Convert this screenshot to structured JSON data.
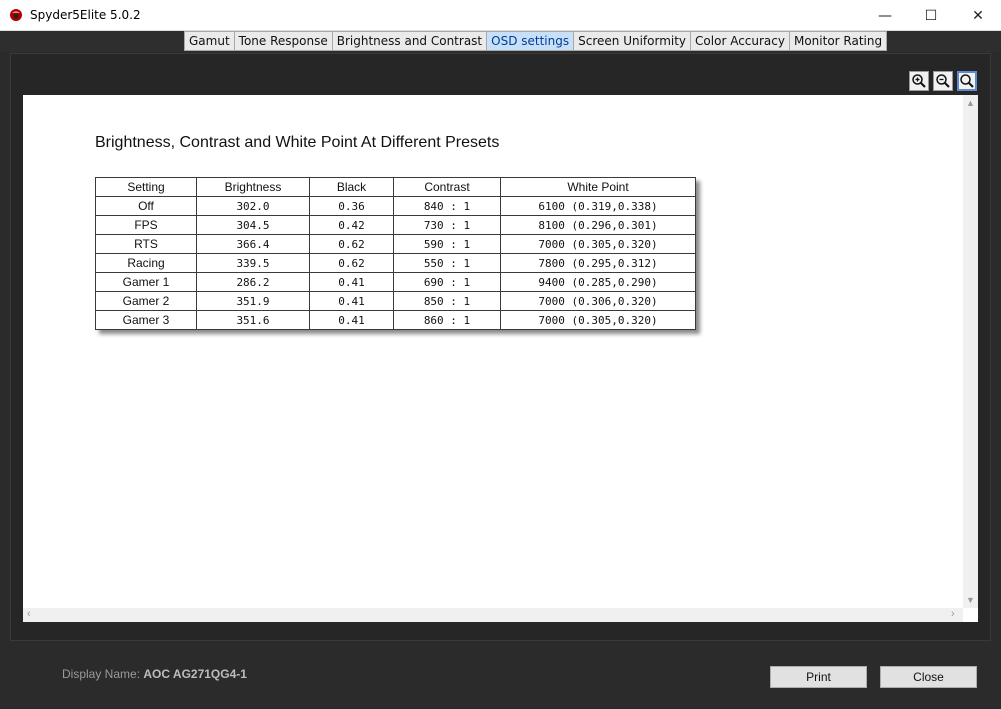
{
  "window": {
    "title": "Spyder5Elite 5.0.2",
    "minimize": "—",
    "maximize": "☐",
    "close": "✕"
  },
  "tabs": [
    {
      "label": "Gamut",
      "active": false
    },
    {
      "label": "Tone Response",
      "active": false
    },
    {
      "label": "Brightness and Contrast",
      "active": false
    },
    {
      "label": "OSD settings",
      "active": true
    },
    {
      "label": "Screen Uniformity",
      "active": false
    },
    {
      "label": "Color Accuracy",
      "active": false
    },
    {
      "label": "Monitor Rating",
      "active": false
    }
  ],
  "zoom_tools": [
    {
      "name": "zoom-in-icon"
    },
    {
      "name": "zoom-out-icon"
    },
    {
      "name": "zoom-fit-icon"
    }
  ],
  "report": {
    "title": "Brightness, Contrast and White Point At Different Presets",
    "columns": [
      "Setting",
      "Brightness",
      "Black",
      "Contrast",
      "White Point"
    ],
    "rows": [
      [
        "Off",
        "302.0",
        "0.36",
        "840 : 1",
        "6100 (0.319,0.338)"
      ],
      [
        "FPS",
        "304.5",
        "0.42",
        "730 : 1",
        "8100 (0.296,0.301)"
      ],
      [
        "RTS",
        "366.4",
        "0.62",
        "590 : 1",
        "7000 (0.305,0.320)"
      ],
      [
        "Racing",
        "339.5",
        "0.62",
        "550 : 1",
        "7800 (0.295,0.312)"
      ],
      [
        "Gamer 1",
        "286.2",
        "0.41",
        "690 : 1",
        "9400 (0.285,0.290)"
      ],
      [
        "Gamer 2",
        "351.9",
        "0.41",
        "850 : 1",
        "7000 (0.306,0.320)"
      ],
      [
        "Gamer 3",
        "351.6",
        "0.41",
        "860 : 1",
        "7000 (0.305,0.320)"
      ]
    ]
  },
  "footer": {
    "display_label": "Display Name: ",
    "display_value": "AOC AG271QG4-1",
    "print_label": "Print",
    "close_label": "Close"
  },
  "colors": {
    "active_tab_bg": "#c7e0f8",
    "frame_bg": "#262626",
    "canvas_bg": "#ffffff"
  }
}
